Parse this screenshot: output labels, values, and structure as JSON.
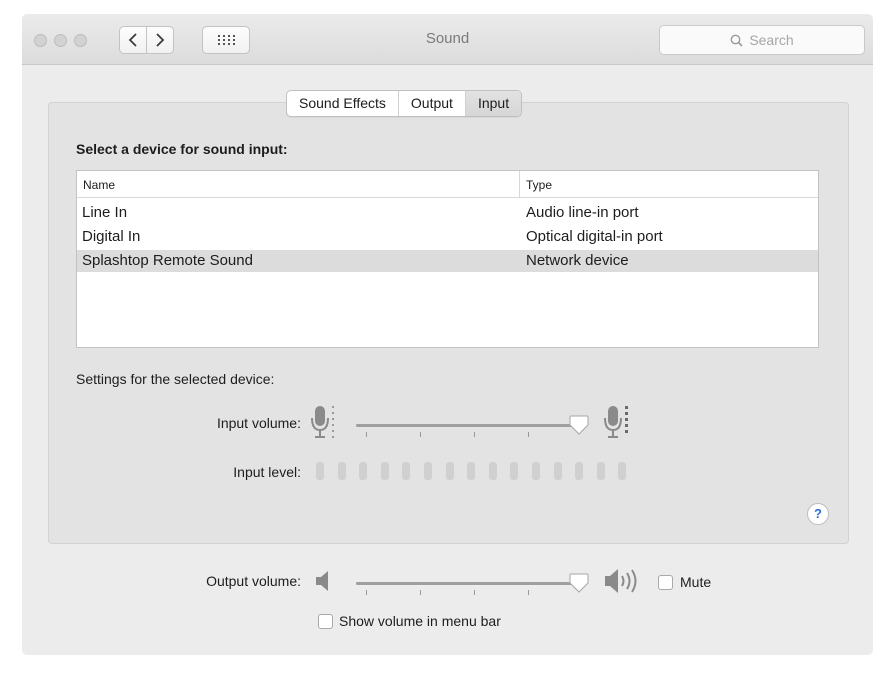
{
  "window": {
    "title": "Sound",
    "search_placeholder": "Search",
    "nav": {
      "back": "‹",
      "forward": "›"
    }
  },
  "tabs": [
    {
      "label": "Sound Effects",
      "selected": false
    },
    {
      "label": "Output",
      "selected": false
    },
    {
      "label": "Input",
      "selected": true
    }
  ],
  "input_panel": {
    "section_title": "Select a device for sound input:",
    "columns": {
      "name": "Name",
      "type": "Type"
    },
    "devices": [
      {
        "name": "Line In",
        "type": "Audio line-in port",
        "selected": false
      },
      {
        "name": "Digital In",
        "type": "Optical digital-in port",
        "selected": false
      },
      {
        "name": "Splashtop Remote Sound",
        "type": "Network device",
        "selected": true
      }
    ],
    "settings_label": "Settings for the selected device:",
    "input_volume_label": "Input volume:",
    "input_volume_fraction": 0.97,
    "input_level_label": "Input level:",
    "input_level_segments": 15,
    "input_level_active": 0,
    "help_label": "?"
  },
  "output": {
    "output_volume_label": "Output volume:",
    "output_volume_fraction": 0.97,
    "mute_label": "Mute",
    "mute_checked": false,
    "show_volume_label": "Show volume in menu bar",
    "show_volume_checked": false
  },
  "colors": {
    "window_bg": "#ececec",
    "panel_bg": "#e3e3e3",
    "selected_row": "#dcdcdc",
    "help_accent": "#2a6fd6"
  },
  "icons": {
    "search": "search-icon",
    "grid": "grid-icon",
    "mic_low": "microphone-low-icon",
    "mic_high": "microphone-high-icon",
    "speaker_low": "speaker-low-icon",
    "speaker_high": "speaker-high-icon"
  }
}
